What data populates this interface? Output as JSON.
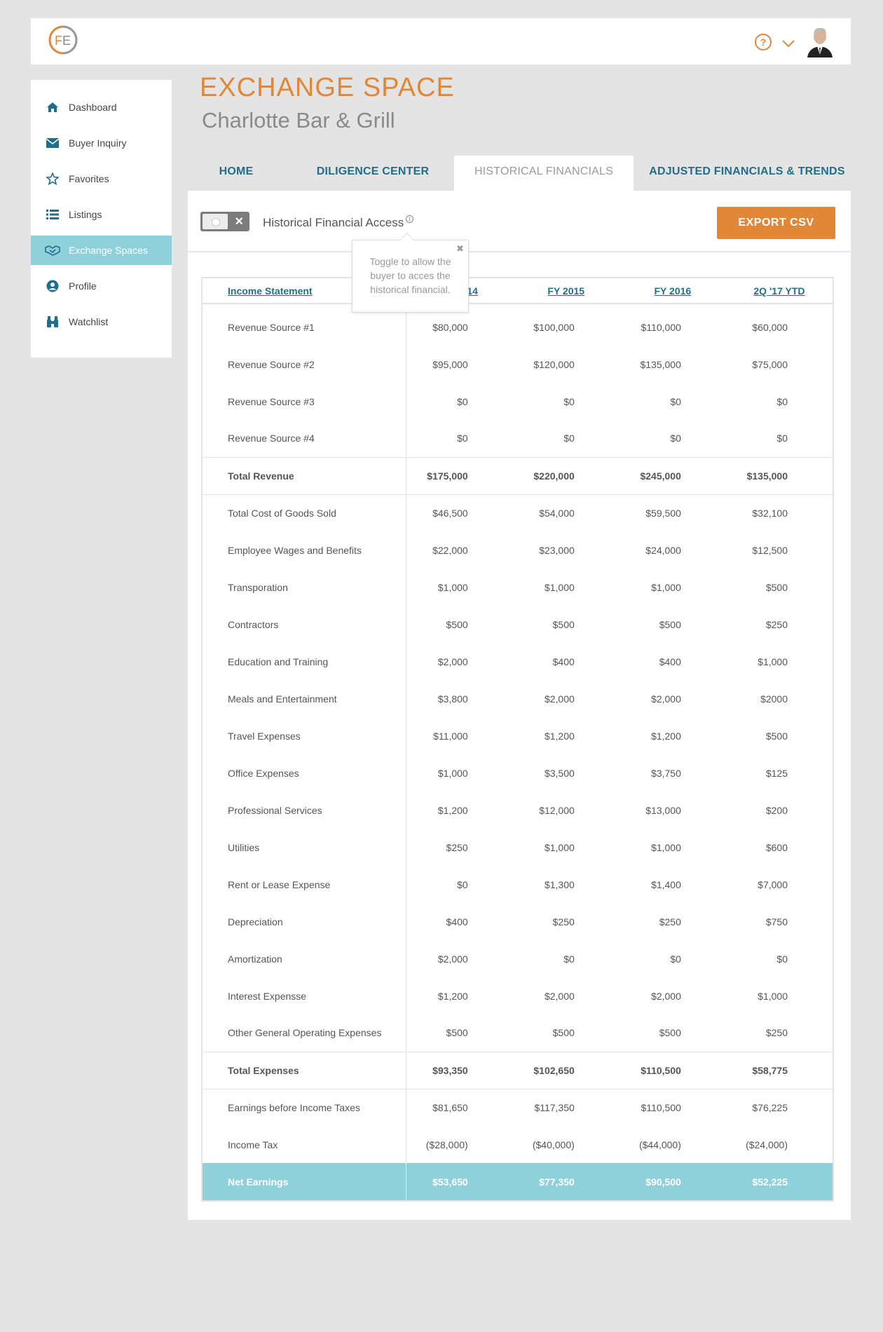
{
  "header": {
    "logo_text": "FE",
    "help_icon": "question-circle-icon",
    "menu_icon": "chevron-down-icon",
    "avatar": "user-avatar"
  },
  "sidebar": {
    "items": [
      {
        "label": "Dashboard",
        "icon": "home-icon"
      },
      {
        "label": "Buyer Inquiry",
        "icon": "envelope-icon"
      },
      {
        "label": "Favorites",
        "icon": "star-icon"
      },
      {
        "label": "Listings",
        "icon": "list-icon"
      },
      {
        "label": "Exchange Spaces",
        "icon": "handshake-icon",
        "active": true
      },
      {
        "label": "Profile",
        "icon": "user-circle-icon"
      },
      {
        "label": "Watchlist",
        "icon": "binoculars-icon"
      }
    ]
  },
  "page": {
    "title": "EXCHANGE SPACE",
    "subtitle": "Charlotte Bar & Grill"
  },
  "tabs": [
    {
      "label": "HOME"
    },
    {
      "label": "DILIGENCE CENTER"
    },
    {
      "label": "HISTORICAL FINANCIALS",
      "active": true
    },
    {
      "label": "ADJUSTED FINANCIALS & TRENDS"
    }
  ],
  "access": {
    "label": "Historical Financial Access",
    "toggle_state": "off",
    "export_label": "EXPORT CSV"
  },
  "tooltip": {
    "text": "Toggle to allow the buyer to acces the historical financial."
  },
  "table": {
    "headers": [
      "Income Statement",
      "FY 2014",
      "FY 2015",
      "FY 2016",
      "2Q '17 YTD"
    ],
    "rows": [
      {
        "label": "Revenue Source #1",
        "values": [
          "$80,000",
          "$100,000",
          "$110,000",
          "$60,000"
        ]
      },
      {
        "label": "Revenue Source #2",
        "values": [
          "$95,000",
          "$120,000",
          "$135,000",
          "$75,000"
        ]
      },
      {
        "label": "Revenue Source #3",
        "values": [
          "$0",
          "$0",
          "$0",
          "$0"
        ]
      },
      {
        "label": "Revenue Source #4",
        "values": [
          "$0",
          "$0",
          "$0",
          "$0"
        ]
      },
      {
        "label": "Total Revenue",
        "values": [
          "$175,000",
          "$220,000",
          "$245,000",
          "$135,000"
        ],
        "type": "total"
      },
      {
        "label": "Total Cost of Goods Sold",
        "values": [
          "$46,500",
          "$54,000",
          "$59,500",
          "$32,100"
        ]
      },
      {
        "label": "Employee Wages and Benefits",
        "values": [
          "$22,000",
          "$23,000",
          "$24,000",
          "$12,500"
        ]
      },
      {
        "label": "Transporation",
        "values": [
          "$1,000",
          "$1,000",
          "$1,000",
          "$500"
        ]
      },
      {
        "label": "Contractors",
        "values": [
          "$500",
          "$500",
          "$500",
          "$250"
        ]
      },
      {
        "label": "Education and Training",
        "values": [
          "$2,000",
          "$400",
          "$400",
          "$1,000"
        ]
      },
      {
        "label": "Meals and Entertainment",
        "values": [
          "$3,800",
          "$2,000",
          "$2,000",
          "$2000"
        ]
      },
      {
        "label": "Travel Expenses",
        "values": [
          "$11,000",
          "$1,200",
          "$1,200",
          "$500"
        ]
      },
      {
        "label": "Office Expenses",
        "values": [
          "$1,000",
          "$3,500",
          "$3,750",
          "$125"
        ]
      },
      {
        "label": "Professional Services",
        "values": [
          "$1,200",
          "$12,000",
          "$13,000",
          "$200"
        ]
      },
      {
        "label": "Utilities",
        "values": [
          "$250",
          "$1,000",
          "$1,000",
          "$600"
        ]
      },
      {
        "label": "Rent or Lease Expense",
        "values": [
          "$0",
          "$1,300",
          "$1,400",
          "$7,000"
        ]
      },
      {
        "label": "Depreciation",
        "values": [
          "$400",
          "$250",
          "$250",
          "$750"
        ]
      },
      {
        "label": "Amortization",
        "values": [
          "$2,000",
          "$0",
          "$0",
          "$0"
        ]
      },
      {
        "label": "Interest Expensse",
        "values": [
          "$1,200",
          "$2,000",
          "$2,000",
          "$1,000"
        ]
      },
      {
        "label": "Other General Operating Expenses",
        "values": [
          "$500",
          "$500",
          "$500",
          "$250"
        ]
      },
      {
        "label": "Total Expenses",
        "values": [
          "$93,350",
          "$102,650",
          "$110,500",
          "$58,775"
        ],
        "type": "total"
      },
      {
        "label": "Earnings before Income Taxes",
        "values": [
          "$81,650",
          "$117,350",
          "$110,500",
          "$76,225"
        ]
      },
      {
        "label": "Income Tax",
        "values": [
          "($28,000)",
          "($40,000)",
          "($44,000)",
          "($24,000)"
        ]
      },
      {
        "label": "Net Earnings",
        "values": [
          "$53,650",
          "$77,350",
          "$90,500",
          "$52,225"
        ],
        "type": "net"
      }
    ]
  },
  "colors": {
    "accent": "#e08838",
    "link": "#1f6f8b",
    "highlight": "#8fd0da"
  }
}
